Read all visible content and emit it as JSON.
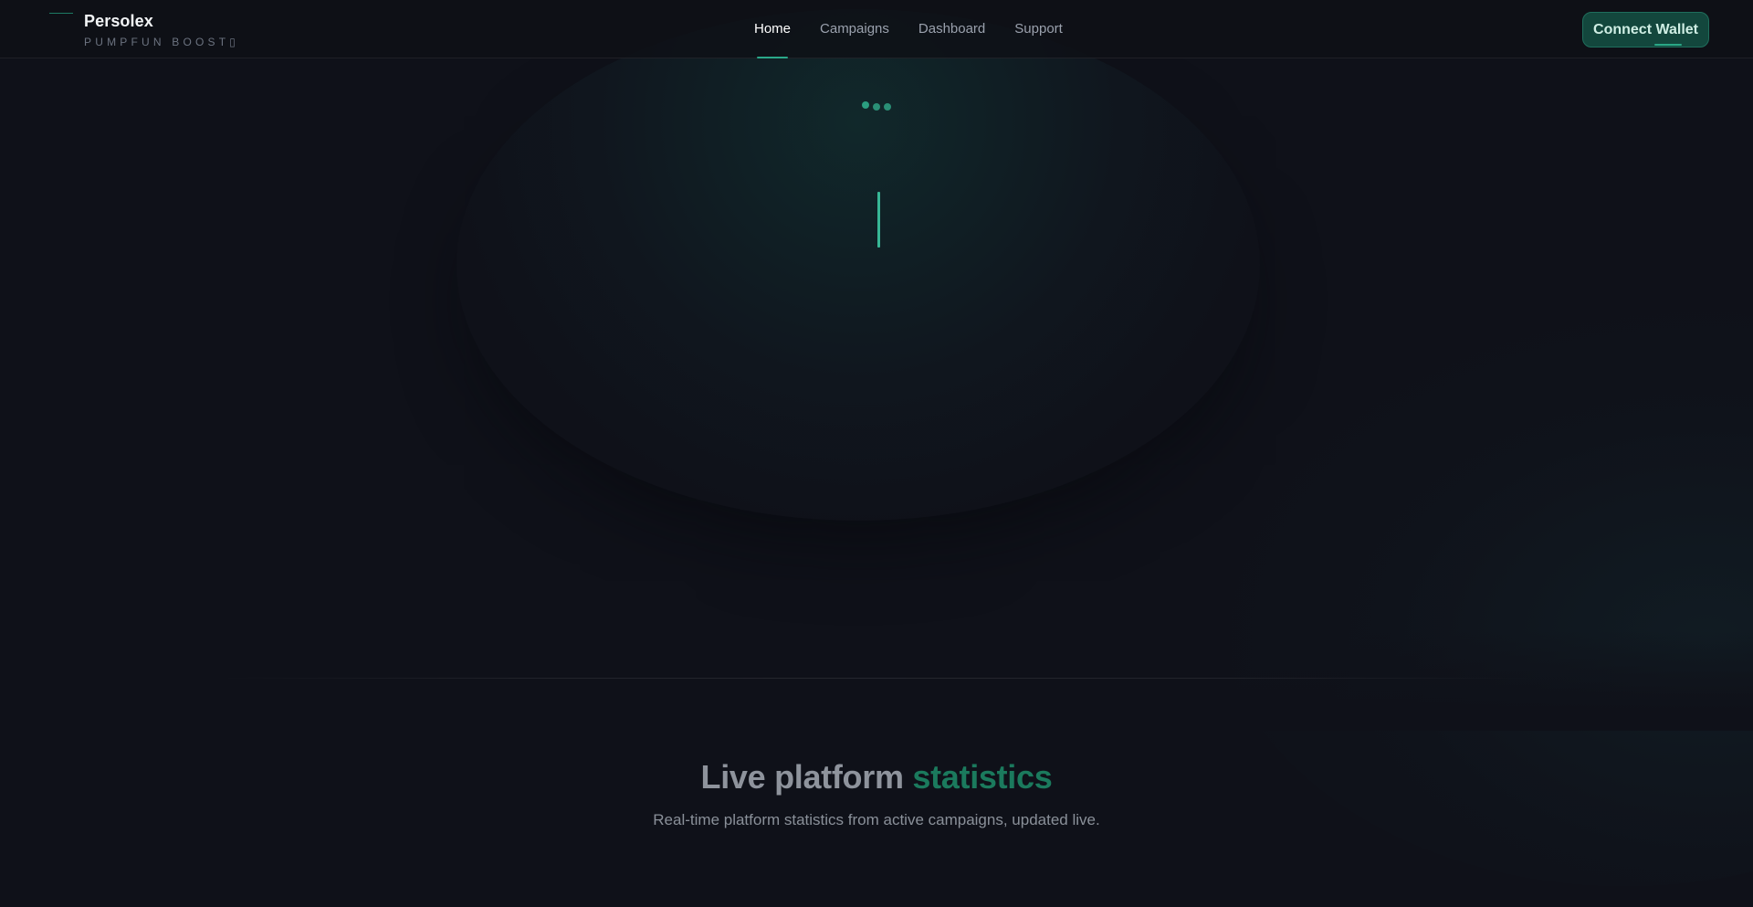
{
  "brand": {
    "name": "Persolex",
    "tagline": "PUMPFUN BOOST▯",
    "accent_color": "#2aa889"
  },
  "nav": {
    "items": [
      {
        "label": "Home",
        "active": true
      },
      {
        "label": "Campaigns",
        "active": false
      },
      {
        "label": "Dashboard",
        "active": false
      },
      {
        "label": "Support",
        "active": false
      }
    ]
  },
  "header": {
    "cta_label": "Connect Wallet"
  },
  "hero": {
    "loading": true
  },
  "stats": {
    "title_prefix": "Live platform",
    "title_accent": "statistics",
    "subtitle": "Real-time platform statistics from active campaigns, updated live."
  },
  "colors": {
    "background": "#0f1119",
    "accent": "#2aa889",
    "accent_dark": "#1b7a5d",
    "button_bg": "#13473d"
  }
}
